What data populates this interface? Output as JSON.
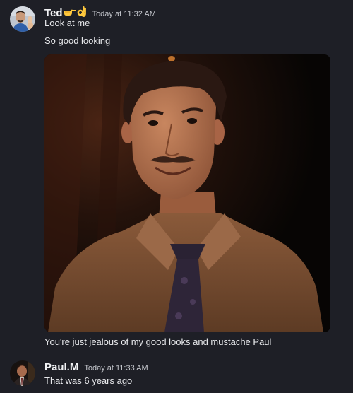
{
  "messages": [
    {
      "author": "Ted",
      "author_emojis": [
        "point-right-emoji",
        "ok-hand-emoji"
      ],
      "timestamp": "Today at 11:32 AM",
      "lines": [
        "Look at me",
        "So good looking"
      ],
      "attachment": {
        "type": "image",
        "subject": "smiling man with a mustache wearing a brown shirt and patterned tie"
      },
      "caption": "You're just jealous of my good looks and mustache Paul"
    },
    {
      "author": "Paul.M",
      "timestamp": "Today at 11:33 AM",
      "lines": [
        "That was 6 years ago"
      ]
    }
  ],
  "colors": {
    "background": "#1e1f26",
    "author": "#f2f3f5",
    "text": "#e8e9ec",
    "timestamp": "#c4c6cc"
  }
}
